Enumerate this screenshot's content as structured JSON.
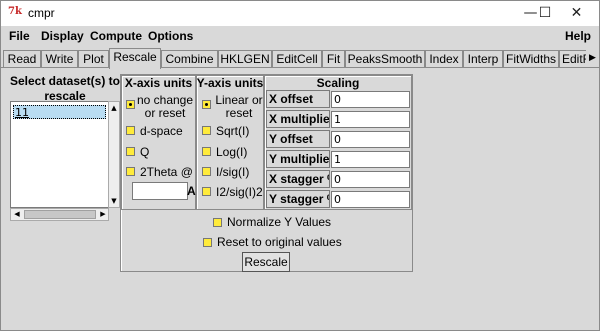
{
  "window": {
    "title": "cmpr",
    "icon_text": "7k"
  },
  "window_controls": {
    "minimize": "—",
    "maximize": "☐",
    "close": "✕"
  },
  "menu": {
    "file": "File",
    "display": "Display",
    "compute": "Compute",
    "options": "Options",
    "help": "Help"
  },
  "tabs": [
    "Read",
    "Write",
    "Plot",
    "Rescale",
    "Combine",
    "HKLGEN",
    "EditCell",
    "Fit",
    "PeaksSmooth",
    "Index",
    "Interp",
    "FitWidths",
    "EditF"
  ],
  "active_tab": "Rescale",
  "datasets": {
    "label": "Select dataset(s) to rescale",
    "items": [
      "11"
    ]
  },
  "x_axis": {
    "title": "X-axis units",
    "options": [
      "no change or reset",
      "d-space",
      "Q",
      "2Theta @"
    ],
    "selected": "no change or reset",
    "wavelength_value": "",
    "wavelength_unit": "A"
  },
  "y_axis": {
    "title": "Y-axis units",
    "options": [
      "Linear or reset",
      "Sqrt(I)",
      "Log(I)",
      "I/sig(I)",
      "I2/sig(I)2"
    ],
    "selected": "Linear or reset"
  },
  "scaling": {
    "title": "Scaling",
    "rows": [
      {
        "label": "X offset",
        "value": "0"
      },
      {
        "label": "X multiplier",
        "value": "1"
      },
      {
        "label": "Y offset",
        "value": "0"
      },
      {
        "label": "Y multiplier",
        "value": "1"
      },
      {
        "label": "X stagger %",
        "value": "0"
      },
      {
        "label": "Y stagger %",
        "value": "0"
      }
    ]
  },
  "options": {
    "normalize_y": "Normalize Y Values",
    "reset_original": "Reset to original values"
  },
  "rescale_button": "Rescale",
  "colors": {
    "selection": "#b9dcf2",
    "indicator": "#ffeb3b",
    "background": "#d9d9d9"
  }
}
